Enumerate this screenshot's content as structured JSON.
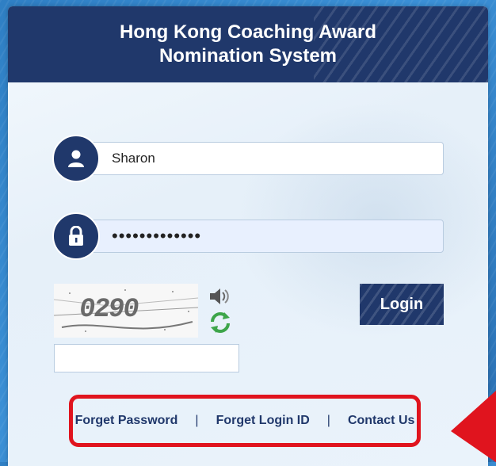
{
  "header": {
    "title_line1": "Hong Kong Coaching Award",
    "title_line2": "Nomination System"
  },
  "form": {
    "username_value": "Sharon",
    "password_value": "•••••••••••••",
    "captcha_image_text": "0290",
    "captcha_input_value": "",
    "login_label": "Login"
  },
  "links": {
    "forget_password": "Forget Password",
    "forget_login_id": "Forget Login ID",
    "contact_us": "Contact Us",
    "separator": "|"
  },
  "icons": {
    "user": "user-icon",
    "lock": "lock-icon",
    "speaker": "speaker-icon",
    "refresh": "refresh-icon"
  },
  "colors": {
    "navy": "#20386b",
    "highlight_red": "#e0141e",
    "background_blue": "#3b90d6"
  }
}
